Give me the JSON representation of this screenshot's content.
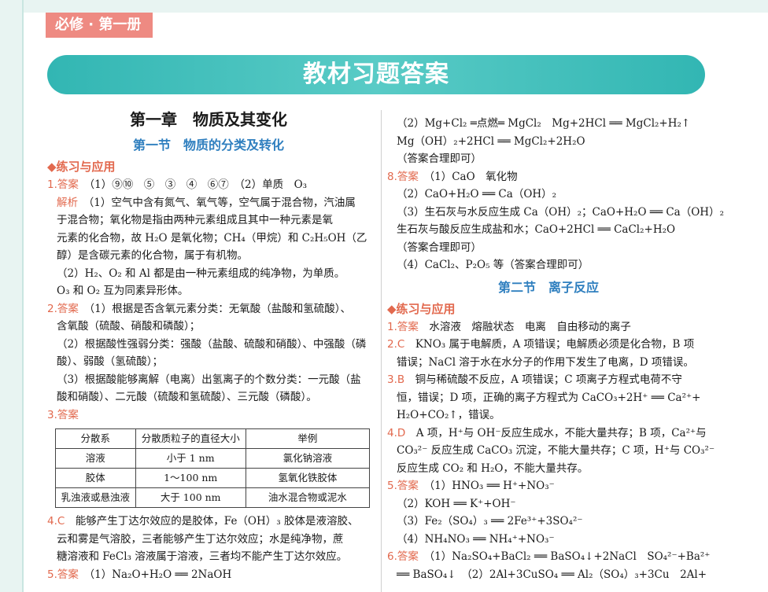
{
  "header": {
    "tag": "必修 · 第一册",
    "banner": "教材习题答案"
  },
  "left": {
    "chapter": "第一章　物质及其变化",
    "section": "第一节　物质的分类及转化",
    "practice": "◆练习与应用",
    "lines": [
      {
        "label": "1.答案",
        "text": "（1）⑨⑩　⑤　③　④　⑥⑦　（2）单质　O₃"
      },
      {
        "label": "解析",
        "text": "（1）空气中含有氮气、氧气等，空气属于混合物，汽油属",
        "exp": true
      },
      {
        "text": "于混合物；氧化物是指由两种元素组成且其中一种元素是氧"
      },
      {
        "text": "元素的化合物，故 H₂O 是氧化物；CH₄（甲烷）和 C₂H₅OH（乙"
      },
      {
        "text": "醇）是含碳元素的化合物，属于有机物。"
      },
      {
        "text": "（2）H₂、O₂ 和 Al 都是由一种元素组成的纯净物，为单质。"
      },
      {
        "text": "O₃ 和 O₂ 互为同素异形体。"
      },
      {
        "label": "2.答案",
        "text": "（1）根据是否含氧元素分类：无氧酸（盐酸和氢硫酸）、"
      },
      {
        "text": "含氧酸（硫酸、硝酸和磷酸）；"
      },
      {
        "text": "（2）根据酸性强弱分类：强酸（盐酸、硫酸和硝酸）、中强酸（磷"
      },
      {
        "text": "酸）、弱酸（氢硫酸）；"
      },
      {
        "text": "（3）根据酸能够离解（电离）出氢离子的个数分类：一元酸（盐"
      },
      {
        "text": "酸和硝酸）、二元酸（硫酸和氢硫酸）、三元酸（磷酸）。"
      },
      {
        "label": "3.答案",
        "text": ""
      }
    ],
    "table": [
      [
        "分散系",
        "分散质粒子的直径大小",
        "举例"
      ],
      [
        "溶液",
        "小于 1 nm",
        "氯化钠溶液"
      ],
      [
        "胶体",
        "1～100 nm",
        "氢氧化铁胶体"
      ],
      [
        "乳浊液或悬浊液",
        "大于 100 nm",
        "油水混合物或泥水"
      ]
    ],
    "after": [
      {
        "label": "4.C",
        "text": "能够产生丁达尔效应的是胶体，Fe（OH）₃ 胶体是液溶胶、"
      },
      {
        "text": "云和雾是气溶胶，三者能够产生丁达尔效应；水是纯净物，蔗"
      },
      {
        "text": "糖溶液和 FeCl₃ 溶液属于溶液，三者均不能产生丁达尔效应。"
      },
      {
        "label": "5.答案",
        "text": "（1）Na₂O+H₂O ══ 2NaOH"
      }
    ]
  },
  "right": {
    "lines": [
      {
        "text": "（2）Mg+Cl₂ ═点燃═ MgCl₂　Mg+2HCl ══ MgCl₂+H₂↑"
      },
      {
        "text": "Mg（OH）₂+2HCl ══ MgCl₂+2H₂O"
      },
      {
        "text": "（答案合理即可）"
      },
      {
        "label": "8.答案",
        "text": "（1）CaO　氧化物"
      },
      {
        "text": "（2）CaO+H₂O ══ Ca（OH）₂"
      },
      {
        "text": "（3）生石灰与水反应生成 Ca（OH）₂；CaO+H₂O ══ Ca（OH）₂"
      },
      {
        "text": "生石灰与酸反应生成盐和水；CaO+2HCl ══ CaCl₂+H₂O"
      },
      {
        "text": "（答案合理即可）"
      },
      {
        "text": "（4）CaCl₂、P₂O₅ 等（答案合理即可）"
      }
    ],
    "section": "第二节　离子反应",
    "practice": "◆练习与应用",
    "lines2": [
      {
        "label": "1.答案",
        "text": "水溶液　熔融状态　电离　自由移动的离子"
      },
      {
        "label": "2.C",
        "text": "KNO₃ 属于电解质，A 项错误；电解质必须是化合物，B 项"
      },
      {
        "text": "错误；NaCl 溶于水在水分子的作用下发生了电离，D 项错误。"
      },
      {
        "label": "3.B",
        "text": "铜与稀硫酸不反应，A 项错误；C 项离子方程式电荷不守"
      },
      {
        "text": "恒，错误；D 项，正确的离子方程式为 CaCO₃+2H⁺ ══ Ca²⁺+"
      },
      {
        "text": "H₂O+CO₂↑，错误。"
      },
      {
        "label": "4.D",
        "text": "A 项，H⁺与 OH⁻反应生成水，不能大量共存；B 项，Ca²⁺与"
      },
      {
        "text": "CO₃²⁻ 反应生成 CaCO₃ 沉淀，不能大量共存；C 项，H⁺与 CO₃²⁻"
      },
      {
        "text": "反应生成 CO₂ 和 H₂O，不能大量共存。"
      },
      {
        "label": "5.答案",
        "text": "（1）HNO₃ ══ H⁺+NO₃⁻"
      },
      {
        "text": "（2）KOH ══ K⁺+OH⁻"
      },
      {
        "text": "（3）Fe₂（SO₄）₃ ══ 2Fe³⁺+3SO₄²⁻"
      },
      {
        "text": "（4）NH₄NO₃ ══ NH₄⁺+NO₃⁻"
      },
      {
        "label": "6.答案",
        "text": "（1）Na₂SO₄+BaCl₂ ══ BaSO₄↓+2NaCl　SO₄²⁻+Ba²⁺"
      },
      {
        "text": "══ BaSO₄↓　（2）2Al+3CuSO₄ ══ Al₂（SO₄）₃+3Cu　2Al+"
      }
    ]
  }
}
